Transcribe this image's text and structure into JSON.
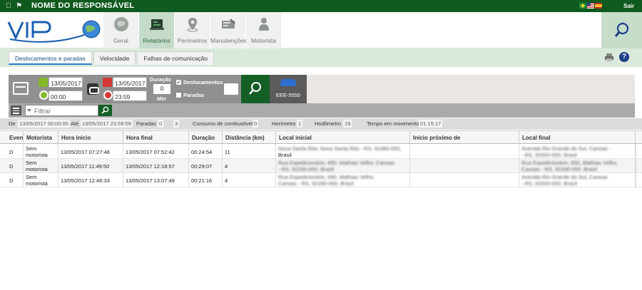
{
  "topbar": {
    "os_icons": " ⚑",
    "user": "NOME DO RESPONSÁVEL",
    "sair": "Sair"
  },
  "nav": {
    "items": [
      "Geral",
      "Relatórios",
      "Perímetros",
      "Manutenções",
      "Motorista"
    ]
  },
  "tabs": [
    "Deslocamentos e paradas",
    "Velocidade",
    "Falhas de comunicação"
  ],
  "help_label": "?",
  "filter": {
    "date_from": "13/05/2017",
    "time_from": "00:00",
    "date_to": "13/05/2017",
    "time_to": "23:59",
    "duracao_label": "Duração",
    "duracao_value": "0",
    "duracao_unit": "Min",
    "deslocamentos_label": "Deslocamentos",
    "deslocamentos_checked": "✓",
    "paradas_label": "Paradas",
    "vehicle_plate": "EEE-5555"
  },
  "gridbar": {
    "filter_placeholder": "Filtrar"
  },
  "summary": {
    "de_label": "De",
    "de_value": "13/05/2017 00:00:00",
    "ate_label": "Até",
    "ate_value": "13/05/2017 23:59:59",
    "paradas_label": "Paradas",
    "paradas_value": "0",
    "paradas_value2": "3",
    "consumo_label": "Consumo de combustível",
    "consumo_value": "0",
    "horimetro_label": "Horímetro",
    "horimetro_value": "1",
    "hodometro_label": "Hodômetro",
    "hodometro_value": "19",
    "tempo_label": "Tempo em movimento",
    "tempo_value": "01:15:17"
  },
  "table": {
    "columns": [
      "Evento",
      "Motorista",
      "Hora início",
      "Hora final",
      "Duração",
      "Distância (km)",
      "Local inicial",
      "Início próximo de",
      "Local final"
    ],
    "rows": [
      {
        "evento": "D",
        "motorista": "Sem motorista",
        "inicio": "13/05/2017 07:27:48",
        "final": "13/05/2017 07:52:42",
        "duracao": "00:24:54",
        "distancia": "11",
        "local_inicial_a": "Nova Santa Rita, Nova Santa Rita - RS, 92480-000,",
        "local_inicial_b": "Brasil",
        "proximo": "",
        "local_final_a": "Avenida Rio Grande do Sul, Canoas -",
        "local_final_b": "- RS, 92000-000, Brasil"
      },
      {
        "evento": "D",
        "motorista": "Sem motorista",
        "inicio": "13/05/2017 11:49:50",
        "final": "13/05/2017 12:18:57",
        "duracao": "00:29:07",
        "distancia": "4",
        "local_inicial_a": "Rua Expedicionário, 650, Mathias Velho, Canoas",
        "local_inicial_b": "- RS, 92330-000, Brasil",
        "proximo": "",
        "local_final_a": "Rua Expedicionário, 650, Mathias Velho,",
        "local_final_b": "Canoas - RS, 92330-000, Brasil"
      },
      {
        "evento": "D",
        "motorista": "Sem motorista",
        "inicio": "13/05/2017 12:46:33",
        "final": "13/05/2017 13:07:49",
        "duracao": "00:21:16",
        "distancia": "4",
        "local_inicial_a": "Rua Expedicionário, 650, Mathias Velho,",
        "local_inicial_b": "Canoas - RS, 92330-000, Brasil",
        "proximo": "",
        "local_final_a": "Avenida Rio Grande do Sul, Canoas",
        "local_final_b": "- RS, 92000-000, Brasil"
      }
    ]
  },
  "colors": {
    "topbar": "#0f5a1e",
    "accent_green": "#145f26",
    "tab_bg": "#d9eadc",
    "date_from": "#84b92a",
    "date_to": "#d63838"
  }
}
